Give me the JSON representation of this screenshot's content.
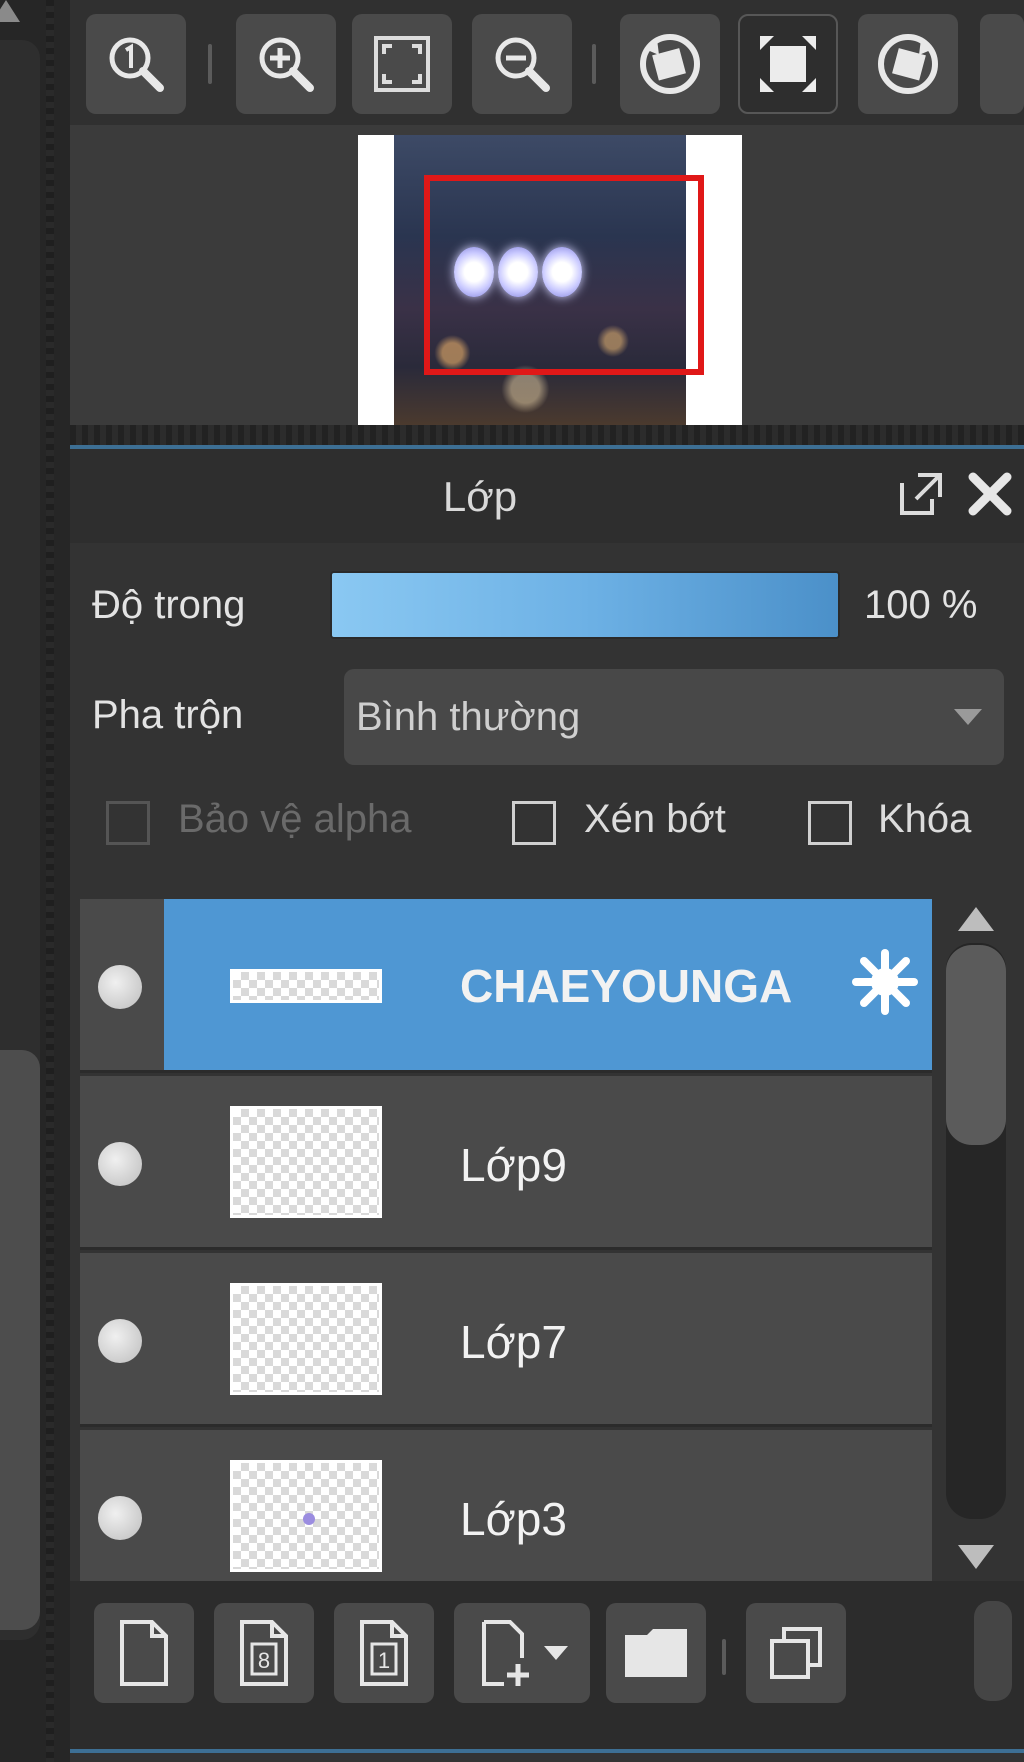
{
  "navigator": {
    "tools": [
      {
        "name": "zoom-actual-icon"
      },
      {
        "name": "zoom-in-icon"
      },
      {
        "name": "fit-screen-icon"
      },
      {
        "name": "zoom-out-icon"
      },
      {
        "name": "rotate-left-icon"
      },
      {
        "name": "reset-rotation-icon"
      },
      {
        "name": "rotate-right-icon"
      }
    ]
  },
  "layer_panel": {
    "title": "Lớp",
    "opacity_label": "Độ trong",
    "opacity_value": "100 %",
    "opacity_level": 1.0,
    "blend_label": "Pha trộn",
    "blend_value": "Bình thường",
    "checkboxes": [
      {
        "label": "Bảo vệ alpha",
        "checked": false,
        "enabled": false
      },
      {
        "label": "Xén bớt",
        "checked": false,
        "enabled": true
      },
      {
        "label": "Khóa",
        "checked": false,
        "enabled": true
      }
    ],
    "layers": [
      {
        "name": "CHAEYOUNGA",
        "selected": true
      },
      {
        "name": "Lớp9",
        "selected": false
      },
      {
        "name": "Lớp7",
        "selected": false
      },
      {
        "name": "Lớp3",
        "selected": false
      }
    ]
  },
  "colors": {
    "selection_accent": "#4f97d3",
    "viewport_rect": "#e01818",
    "panel_bg": "#333333"
  }
}
